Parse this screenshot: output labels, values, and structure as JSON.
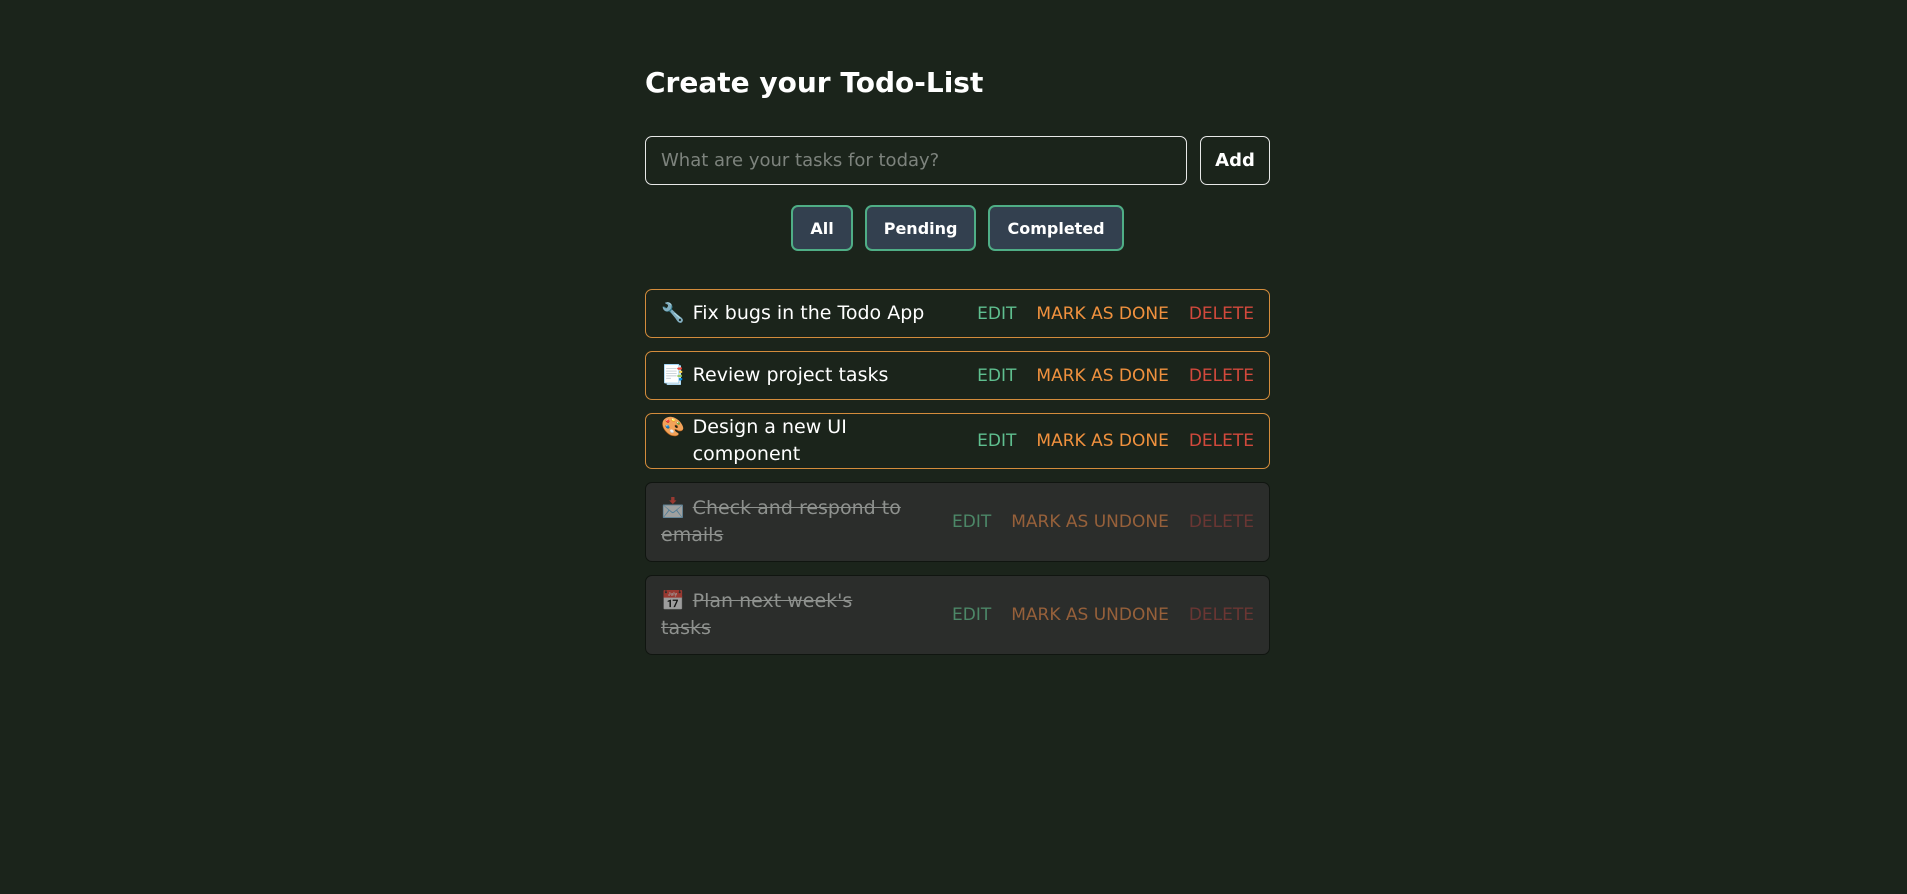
{
  "header": {
    "title": "Create your Todo-List"
  },
  "add_form": {
    "placeholder": "What are your tasks for today?",
    "value": "",
    "add_label": "Add"
  },
  "filters": [
    {
      "label": "All"
    },
    {
      "label": "Pending"
    },
    {
      "label": "Completed"
    }
  ],
  "todos": [
    {
      "emoji": "🔧",
      "text": "Fix bugs in the Todo App",
      "done": false,
      "edit_label": "EDIT",
      "toggle_label": "MARK AS DONE",
      "delete_label": "DELETE"
    },
    {
      "emoji": "📑",
      "text": "Review project tasks",
      "done": false,
      "edit_label": "EDIT",
      "toggle_label": "MARK AS DONE",
      "delete_label": "DELETE"
    },
    {
      "emoji": "🎨",
      "text": "Design a new UI component",
      "done": false,
      "edit_label": "EDIT",
      "toggle_label": "MARK AS DONE",
      "delete_label": "DELETE"
    },
    {
      "emoji": "📩",
      "text": "Check and respond to emails",
      "done": true,
      "edit_label": "EDIT",
      "toggle_label": "MARK AS UNDONE",
      "delete_label": "DELETE"
    },
    {
      "emoji": "📅",
      "text": "Plan next week's tasks",
      "done": true,
      "edit_label": "EDIT",
      "toggle_label": "MARK AS UNDONE",
      "delete_label": "DELETE"
    }
  ],
  "colors": {
    "background": "#1b241b",
    "pending_border": "#d48c3c",
    "filter_border": "#4fae86",
    "filter_bg": "#33404f",
    "edit": "#5fbf8f",
    "toggle": "#f0913e",
    "delete": "#d2493c"
  }
}
